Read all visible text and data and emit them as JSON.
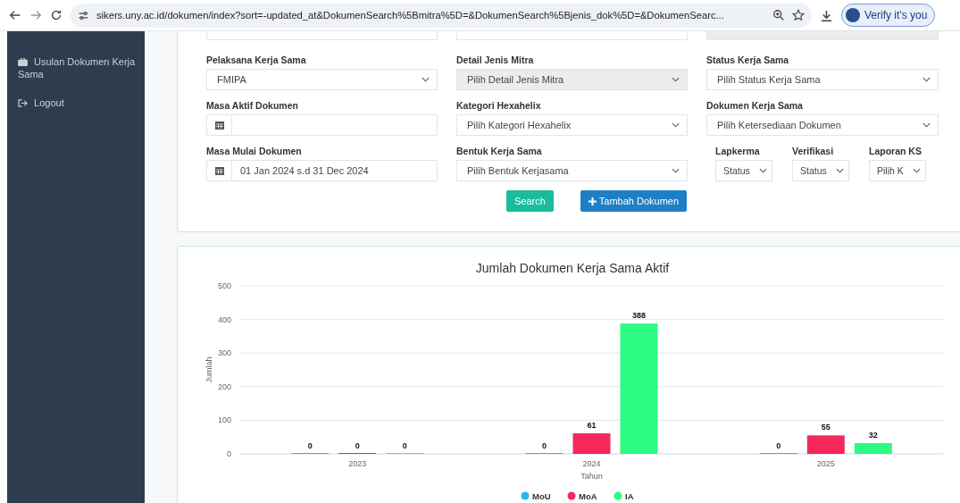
{
  "browser": {
    "url": "sikers.uny.ac.id/dokumen/index?sort=-updated_at&DokumenSearch%5Bmitra%5D=&DokumenSearch%5Bjenis_dok%5D=&DokumenSearc...",
    "profile_button": "Verify it's you"
  },
  "sidebar": {
    "items": [
      {
        "label": "Usulan Dokumen Kerja Sama",
        "kind": "briefcase"
      },
      {
        "label": "Logout",
        "kind": "logout"
      }
    ]
  },
  "filters": {
    "top_row": [
      {
        "disabled": false
      },
      {
        "disabled": false
      },
      {
        "disabled": true
      }
    ],
    "rows": [
      [
        {
          "label": "Pelaksana Kerja Sama",
          "kind": "select",
          "value": "FMIPA",
          "disabled": false
        },
        {
          "label": "Detail Jenis Mitra",
          "kind": "select",
          "value": "Pilih Detail Jenis Mitra",
          "disabled": true
        },
        {
          "label": "Status Kerja Sama",
          "kind": "select",
          "value": "Pilih Status Kerja Sama",
          "disabled": false
        }
      ],
      [
        {
          "label": "Masa Aktif Dokumen",
          "kind": "date",
          "disabled": false
        },
        {
          "label": "Kategori Hexahelix",
          "kind": "select",
          "value": "Pilih Kategori Hexahelix",
          "disabled": false
        },
        {
          "label": "Dokumen Kerja Sama",
          "kind": "select",
          "value": "Pilih Ketersediaan Dokumen",
          "disabled": false
        }
      ],
      [
        {
          "label": "Masa Mulai Dokumen",
          "kind": "date",
          "value": "01 Jan 2024 s.d 31 Dec 2024",
          "disabled": false
        },
        {
          "label": "Bentuk Kerja Sama",
          "kind": "select",
          "value": "Pilih Bentuk Kerjasama",
          "disabled": false
        },
        {
          "kind": "group",
          "items": [
            {
              "label": "Lapkerma",
              "value": "Status"
            },
            {
              "label": "Verifikasi",
              "value": "Status"
            },
            {
              "label": "Laporan KS",
              "value": "Pilih K"
            }
          ]
        }
      ]
    ],
    "buttons": [
      {
        "label": "Search",
        "kind": "search"
      },
      {
        "label": "Tambah Dokumen",
        "kind": "add"
      }
    ]
  },
  "chart": {
    "chart_data": {
      "type": "bar",
      "title": "Jumlah Dokumen Kerja Sama Aktif",
      "xlabel": "Tahun",
      "ylabel": "Jumlah",
      "categories": [
        "2023",
        "2024",
        "2025"
      ],
      "series": [
        {
          "name": "MoU",
          "color": "#2ab7f5",
          "values": [
            0,
            0,
            0
          ]
        },
        {
          "name": "MoA",
          "color": "#f5285c",
          "values": [
            0,
            61,
            55
          ]
        },
        {
          "name": "IA",
          "color": "#2cfc82",
          "values": [
            0,
            388,
            32
          ]
        }
      ],
      "ylim": [
        0,
        500
      ],
      "grid": true,
      "legend": "bottom",
      "yticks": [
        0,
        100,
        200,
        300,
        400,
        500
      ],
      "data_labels": true
    }
  }
}
